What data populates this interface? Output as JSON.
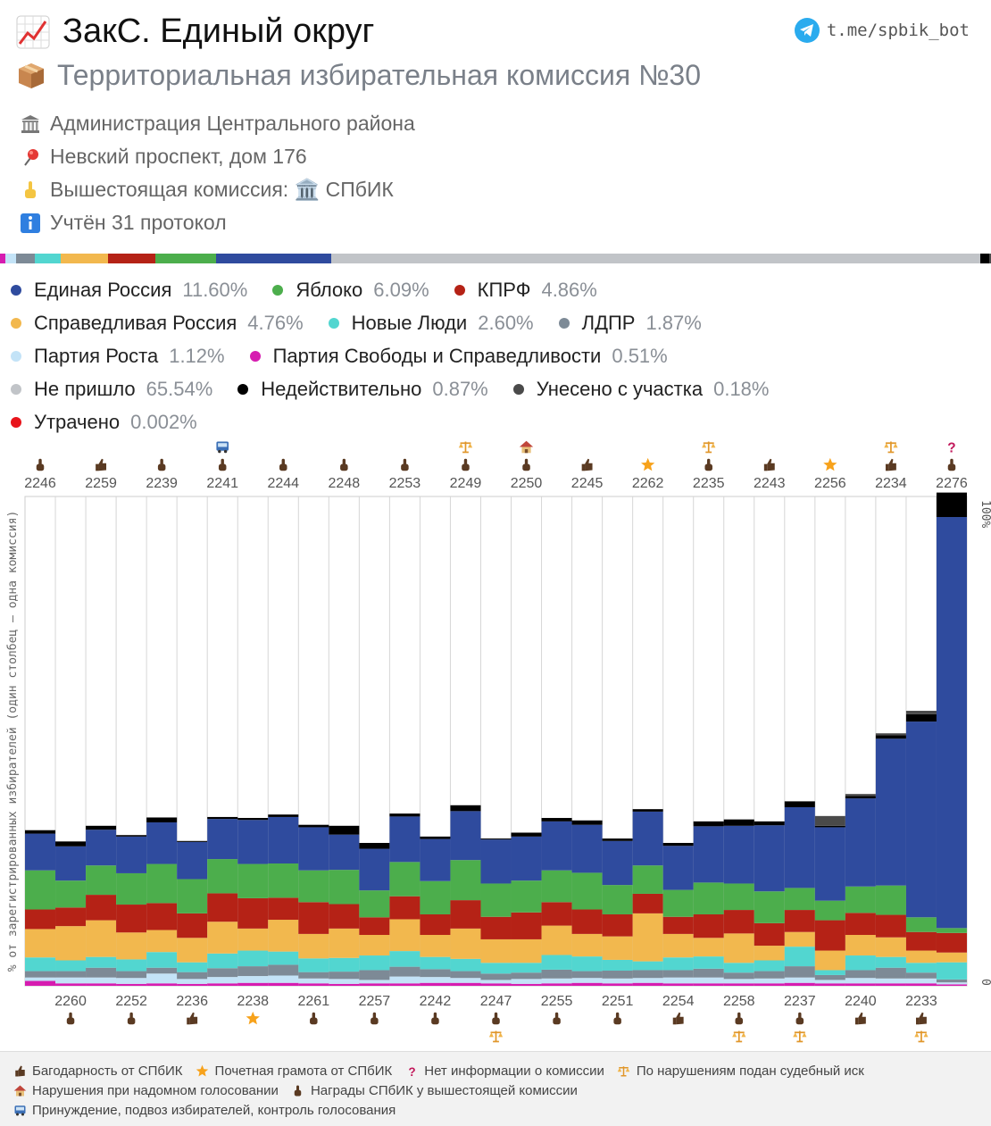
{
  "header": {
    "title": "ЗакС. Единый округ",
    "bot": "t.me/spbik_bot",
    "subtitle": "Территориальная избирательная комиссия №30",
    "info": [
      {
        "icon": "building-icon",
        "text": "Администрация Центрального района"
      },
      {
        "icon": "pin-icon",
        "text": "Невский проспект, дом 176"
      },
      {
        "icon": "point-up-icon",
        "text": "Вышестоящая комиссия: 🏛️ СПбИК"
      },
      {
        "icon": "info-icon",
        "text": "Учтён 31 протокол"
      }
    ]
  },
  "parties": [
    {
      "name": "Единая Россия",
      "value": "11.60%",
      "color": "#2f4b9e"
    },
    {
      "name": "Яблоко",
      "value": "6.09%",
      "color": "#4cae4c"
    },
    {
      "name": "КПРФ",
      "value": "4.86%",
      "color": "#b52216"
    },
    {
      "name": "Справедливая Россия",
      "value": "4.76%",
      "color": "#f2b84e"
    },
    {
      "name": "Новые Люди",
      "value": "2.60%",
      "color": "#52d6d0"
    },
    {
      "name": "ЛДПР",
      "value": "1.87%",
      "color": "#7d8a96"
    },
    {
      "name": "Партия Роста",
      "value": "1.12%",
      "color": "#c3e3f7"
    },
    {
      "name": "Партия Свободы и Справедливости",
      "value": "0.51%",
      "color": "#d61cb0"
    },
    {
      "name": "Не пришло",
      "value": "65.54%",
      "color": "#c1c4c8"
    },
    {
      "name": "Недействительно",
      "value": "0.87%",
      "color": "#000000"
    },
    {
      "name": "Унесено с участка",
      "value": "0.18%",
      "color": "#4a4a4a"
    },
    {
      "name": "Утрачено",
      "value": "0.002%",
      "color": "#e8141b"
    }
  ],
  "chart_data": {
    "type": "bar",
    "stacked": true,
    "ylabel": "% от зарегистрированных избирателей (один столбец — одна комиссия)",
    "ylim": [
      0,
      100
    ],
    "y_ticks": [
      "100%",
      "0"
    ],
    "categories": [
      "2246",
      "2260",
      "2259",
      "2252",
      "2239",
      "2236",
      "2241",
      "2238",
      "2244",
      "2261",
      "2248",
      "2257",
      "2253",
      "2242",
      "2249",
      "2247",
      "2250",
      "2255",
      "2245",
      "2251",
      "2262",
      "2254",
      "2235",
      "2258",
      "2243",
      "2237",
      "2256",
      "2240",
      "2234",
      "2233",
      "2276"
    ],
    "series_order": [
      "ПСС",
      "Партия Роста",
      "ЛДПР",
      "Новые Люди",
      "Справедливая Россия",
      "КПРФ",
      "Яблоко",
      "Единая Россия",
      "Недействительно",
      "Унесено с участка"
    ],
    "series": [
      {
        "name": "Партия Свободы и Справедливости",
        "values": [
          1.0,
          0.5,
          0.5,
          0.4,
          0.5,
          0.4,
          0.5,
          0.6,
          0.6,
          0.5,
          0.4,
          0.5,
          0.5,
          0.6,
          0.6,
          0.5,
          0.4,
          0.5,
          0.6,
          0.5,
          0.6,
          0.5,
          0.5,
          0.5,
          0.5,
          0.6,
          0.5,
          0.5,
          0.5,
          0.5,
          0.3
        ]
      },
      {
        "name": "Партия Роста",
        "values": [
          0.7,
          1.2,
          1.2,
          1.2,
          2.0,
          1.0,
          1.3,
          1.4,
          1.5,
          1.0,
          1.0,
          0.7,
          1.4,
          1.2,
          1.0,
          0.7,
          1.0,
          1.0,
          1.0,
          1.0,
          1.0,
          1.2,
          1.2,
          0.9,
          1.0,
          1.1,
          0.7,
          1.1,
          1.0,
          1.0,
          0.4
        ]
      },
      {
        "name": "ЛДПР",
        "values": [
          1.3,
          1.3,
          2.0,
          1.4,
          1.2,
          1.4,
          1.8,
          2.0,
          2.2,
          1.3,
          1.5,
          2.0,
          2.0,
          1.6,
          1.4,
          1.3,
          1.3,
          1.8,
          1.4,
          1.6,
          1.6,
          1.5,
          1.8,
          1.3,
          1.5,
          2.3,
          1.0,
          1.6,
          2.2,
          1.2,
          0.6
        ]
      },
      {
        "name": "Новые Люди",
        "values": [
          2.8,
          2.2,
          2.2,
          2.4,
          3.2,
          2.0,
          3.0,
          3.2,
          2.7,
          2.8,
          2.8,
          3.0,
          3.2,
          2.5,
          2.5,
          2.2,
          2.0,
          3.0,
          3.0,
          2.2,
          1.8,
          2.6,
          2.5,
          2.0,
          2.2,
          4.0,
          1.0,
          3.0,
          2.2,
          2.0,
          3.5
        ]
      },
      {
        "name": "Справедливая Россия",
        "values": [
          5.8,
          7.0,
          7.5,
          5.5,
          4.5,
          5.0,
          6.5,
          4.5,
          6.5,
          5.0,
          6.0,
          4.2,
          6.5,
          4.5,
          6.2,
          4.8,
          4.8,
          6.0,
          4.6,
          4.8,
          9.8,
          4.8,
          3.8,
          6.0,
          3.0,
          3.0,
          4.0,
          4.2,
          4.0,
          2.5,
          2.0
        ]
      },
      {
        "name": "КПРФ",
        "values": [
          4.0,
          3.8,
          5.2,
          5.7,
          5.5,
          5.0,
          5.8,
          6.2,
          4.5,
          6.5,
          5.0,
          3.6,
          4.7,
          4.2,
          5.8,
          4.6,
          5.5,
          4.8,
          5.0,
          4.5,
          4.0,
          3.5,
          4.8,
          4.8,
          4.6,
          4.5,
          6.2,
          4.5,
          4.6,
          3.8,
          4.0
        ]
      },
      {
        "name": "Яблоко",
        "values": [
          8.0,
          5.5,
          6.0,
          6.4,
          8.0,
          7.0,
          7.0,
          7.0,
          7.0,
          6.5,
          7.0,
          5.5,
          7.0,
          6.8,
          8.2,
          6.8,
          6.5,
          6.5,
          7.5,
          6.0,
          5.8,
          5.5,
          6.5,
          5.4,
          6.5,
          4.5,
          4.0,
          5.4,
          6.0,
          3.0,
          1.0
        ]
      },
      {
        "name": "Единая Россия",
        "values": [
          7.5,
          7.0,
          7.3,
          7.5,
          8.5,
          7.6,
          8.2,
          9.0,
          9.5,
          8.8,
          7.2,
          8.5,
          9.3,
          8.6,
          10.0,
          9.0,
          9.0,
          10.0,
          9.8,
          9.0,
          11.0,
          9.0,
          11.5,
          11.8,
          13.5,
          16.5,
          15.0,
          18.0,
          30.0,
          40.0,
          84.0
        ]
      },
      {
        "name": "Недействительно",
        "values": [
          0.7,
          1.0,
          0.8,
          0.3,
          1.0,
          0.2,
          0.4,
          0.4,
          0.5,
          0.5,
          1.8,
          1.2,
          0.6,
          0.5,
          1.2,
          0.2,
          0.8,
          0.7,
          0.9,
          0.5,
          0.5,
          0.6,
          1.0,
          1.3,
          0.8,
          1.2,
          0.3,
          0.5,
          0.7,
          1.5,
          5.0
        ]
      },
      {
        "name": "Унесено с участка",
        "values": [
          0,
          0,
          0,
          0,
          0,
          0,
          0,
          0,
          0,
          0,
          0,
          0,
          0,
          0,
          0,
          0,
          0,
          0,
          0,
          0,
          0,
          0,
          0,
          0,
          0,
          0,
          2.0,
          0.4,
          0.4,
          0.7,
          0
        ]
      }
    ],
    "top_awards": [
      [
        "thumb"
      ],
      [
        "thumbs-up"
      ],
      [
        "thumb"
      ],
      [
        "bus",
        "thumb"
      ],
      [
        "thumb"
      ],
      [
        "thumb"
      ],
      [
        "thumb"
      ],
      [
        "scales",
        "thumb"
      ],
      [
        "house",
        "thumb"
      ],
      [
        "thumbs-up"
      ],
      [
        "star"
      ],
      [
        "scales",
        "thumb"
      ],
      [
        "thumbs-up"
      ],
      [
        "star"
      ],
      [
        "scales",
        "thumbs-up"
      ],
      [
        "question",
        "thumb"
      ]
    ],
    "bottom_awards": [
      [
        "thumb"
      ],
      [
        "thumb"
      ],
      [
        "thumbs-up"
      ],
      [
        "star"
      ],
      [
        "thumb"
      ],
      [
        "thumb"
      ],
      [
        "thumb"
      ],
      [
        "thumb",
        "scales"
      ],
      [
        "thumb"
      ],
      [
        "thumb"
      ],
      [
        "thumbs-up"
      ],
      [
        "thumb",
        "scales"
      ],
      [
        "thumb",
        "scales"
      ],
      [
        "thumbs-up"
      ],
      [
        "thumbs-up",
        "scales"
      ]
    ]
  },
  "footer": [
    {
      "icon": "thumbs-up-icon",
      "text": "Багодарность от СПбИК"
    },
    {
      "icon": "star-icon",
      "text": "Почетная грамота от СПбИК"
    },
    {
      "icon": "question-icon",
      "text": "Нет информации о комиссии"
    },
    {
      "icon": "scales-icon",
      "text": "По нарушениям подан судебный иск"
    },
    {
      "icon": "house-icon",
      "text": "Нарушения при надомном голосовании"
    },
    {
      "icon": "thumb-icon",
      "text": "Награды СПбИК у вышестоящей комиссии"
    },
    {
      "icon": "bus-icon",
      "text": "Принуждение, подвоз избирателей, контроль голосования"
    }
  ]
}
